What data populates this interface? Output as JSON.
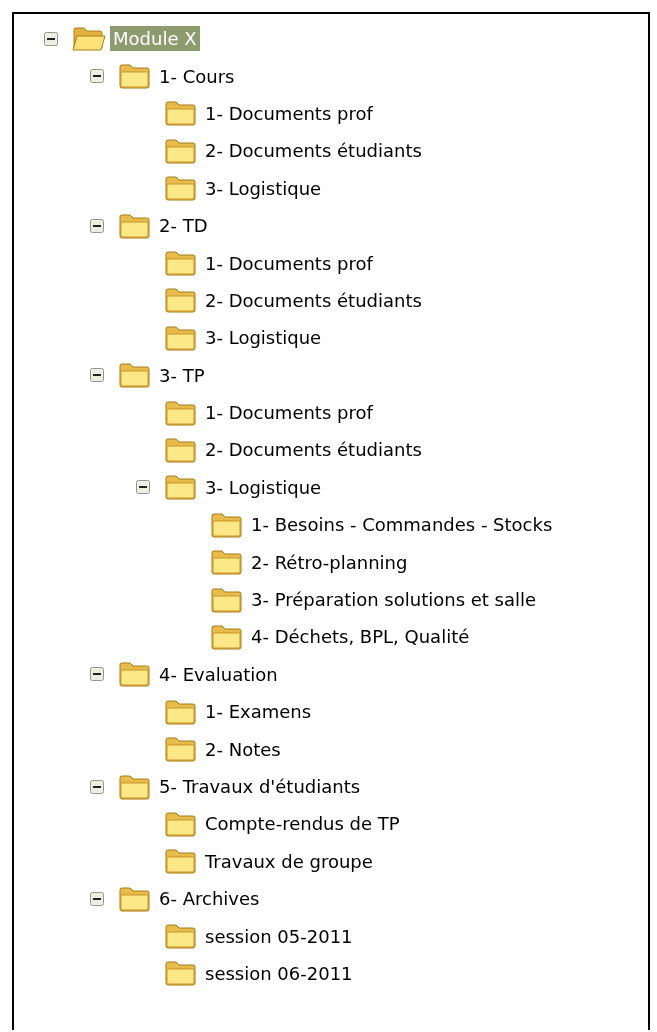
{
  "tree": [
    {
      "label": "Module X",
      "selected": true,
      "expanded": true,
      "children": [
        {
          "label": "1- Cours",
          "selected": false,
          "expanded": true,
          "children": [
            {
              "label": "1- Documents prof",
              "selected": false
            },
            {
              "label": "2- Documents étudiants",
              "selected": false
            },
            {
              "label": "3- Logistique",
              "selected": false
            }
          ]
        },
        {
          "label": "2- TD",
          "selected": false,
          "expanded": true,
          "children": [
            {
              "label": "1- Documents prof",
              "selected": false
            },
            {
              "label": "2- Documents étudiants",
              "selected": false
            },
            {
              "label": "3- Logistique",
              "selected": false
            }
          ]
        },
        {
          "label": "3- TP",
          "selected": false,
          "expanded": true,
          "children": [
            {
              "label": "1- Documents prof",
              "selected": false
            },
            {
              "label": "2- Documents étudiants",
              "selected": false
            },
            {
              "label": "3- Logistique",
              "selected": false,
              "expanded": true,
              "children": [
                {
                  "label": "1- Besoins - Commandes - Stocks",
                  "selected": false
                },
                {
                  "label": "2- Rétro-planning",
                  "selected": false
                },
                {
                  "label": "3- Préparation solutions et salle",
                  "selected": false
                },
                {
                  "label": "4- Déchets, BPL, Qualité",
                  "selected": false
                }
              ]
            }
          ]
        },
        {
          "label": "4- Evaluation",
          "selected": false,
          "expanded": true,
          "children": [
            {
              "label": "1- Examens",
              "selected": false
            },
            {
              "label": "2- Notes",
              "selected": false
            }
          ]
        },
        {
          "label": "5- Travaux d'étudiants",
          "selected": false,
          "expanded": true,
          "children": [
            {
              "label": "Compte-rendus de TP",
              "selected": false
            },
            {
              "label": "Travaux de groupe",
              "selected": false
            }
          ]
        },
        {
          "label": "6- Archives",
          "selected": false,
          "expanded": true,
          "children": [
            {
              "label": "session 05-2011",
              "selected": false
            },
            {
              "label": "session 06-2011",
              "selected": false
            }
          ]
        }
      ]
    }
  ]
}
